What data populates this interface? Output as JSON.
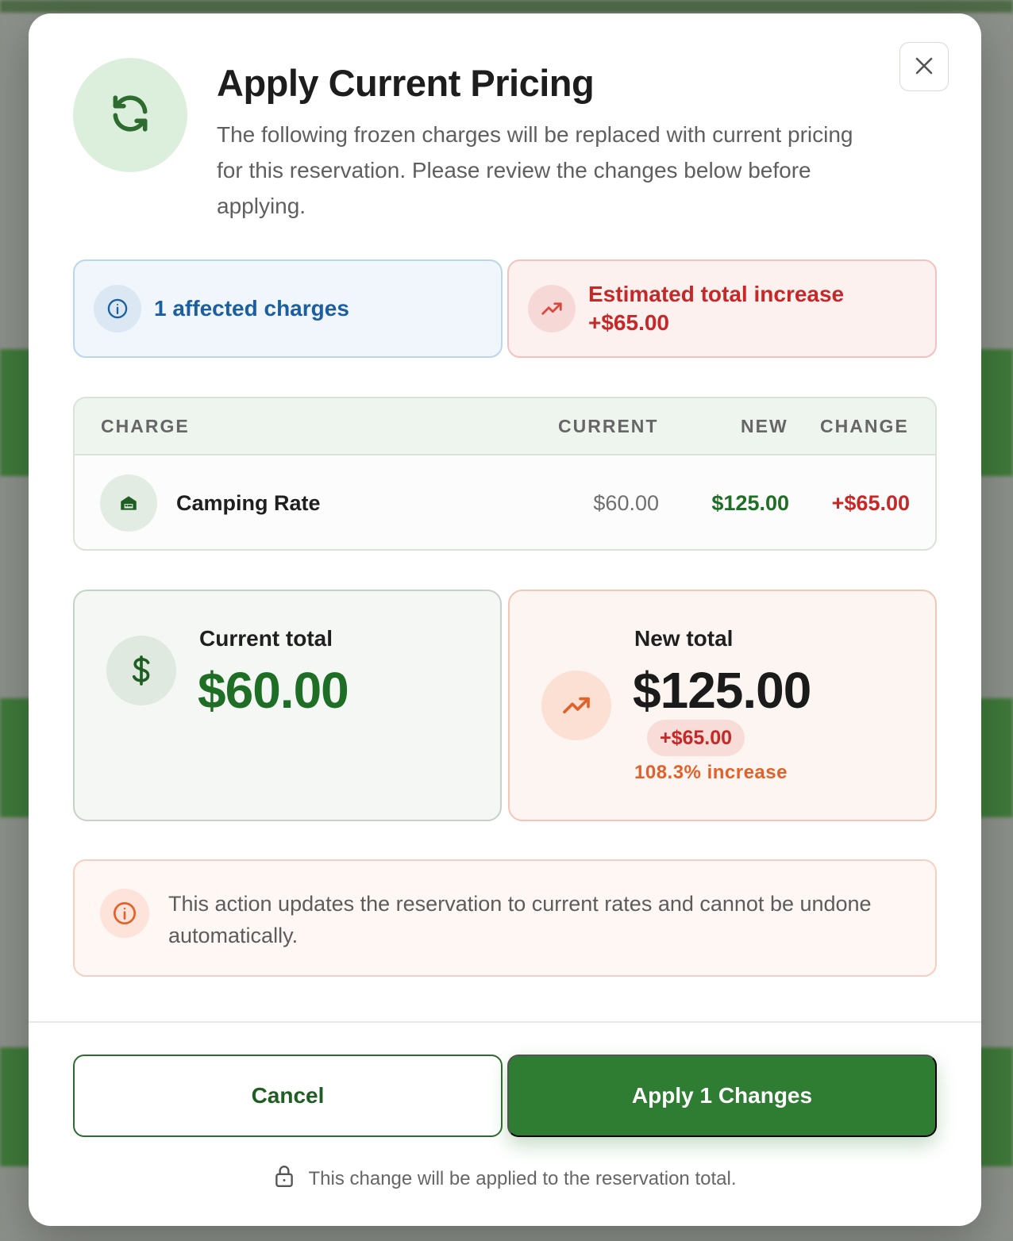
{
  "dialog": {
    "title": "Apply Current Pricing",
    "subtitle": "The following frozen charges will be replaced with current pricing for this reservation. Please review the changes below before applying.",
    "header_icon": "refresh-icon",
    "close_icon": "close-icon"
  },
  "stats": {
    "affected": {
      "text": "1 affected charges",
      "icon": "info-icon"
    },
    "increase": {
      "label": "Estimated total increase",
      "value": "+$65.00",
      "icon": "trending-up-icon"
    }
  },
  "table": {
    "headers": {
      "charge": "CHARGE",
      "current": "CURRENT",
      "new": "NEW",
      "change": "CHANGE"
    },
    "rows": [
      {
        "icon": "bed-icon",
        "charge": "Camping Rate",
        "current": "$60.00",
        "new": "$125.00",
        "change": "+$65.00"
      }
    ]
  },
  "totals": {
    "current": {
      "label": "Current total",
      "value": "$60.00",
      "icon": "dollar-icon"
    },
    "new": {
      "label": "New total",
      "value": "$125.00",
      "delta": "+$65.00",
      "percent": "108.3% increase",
      "icon": "trending-up-icon"
    }
  },
  "notice": {
    "text": "This action updates the reservation to current rates and cannot be undone automatically.",
    "icon": "info-icon"
  },
  "actions": {
    "cancel_label": "Cancel",
    "apply_label": "Apply 1 Changes"
  },
  "footnote": {
    "text": "This change will be applied to the reservation total.",
    "icon": "lock-icon"
  },
  "colors": {
    "brand_green": "#2e7d32",
    "dark_green": "#1f5e22",
    "increase_red": "#c62828",
    "info_blue": "#1b5fa0",
    "accent_orange": "#e0622a"
  }
}
